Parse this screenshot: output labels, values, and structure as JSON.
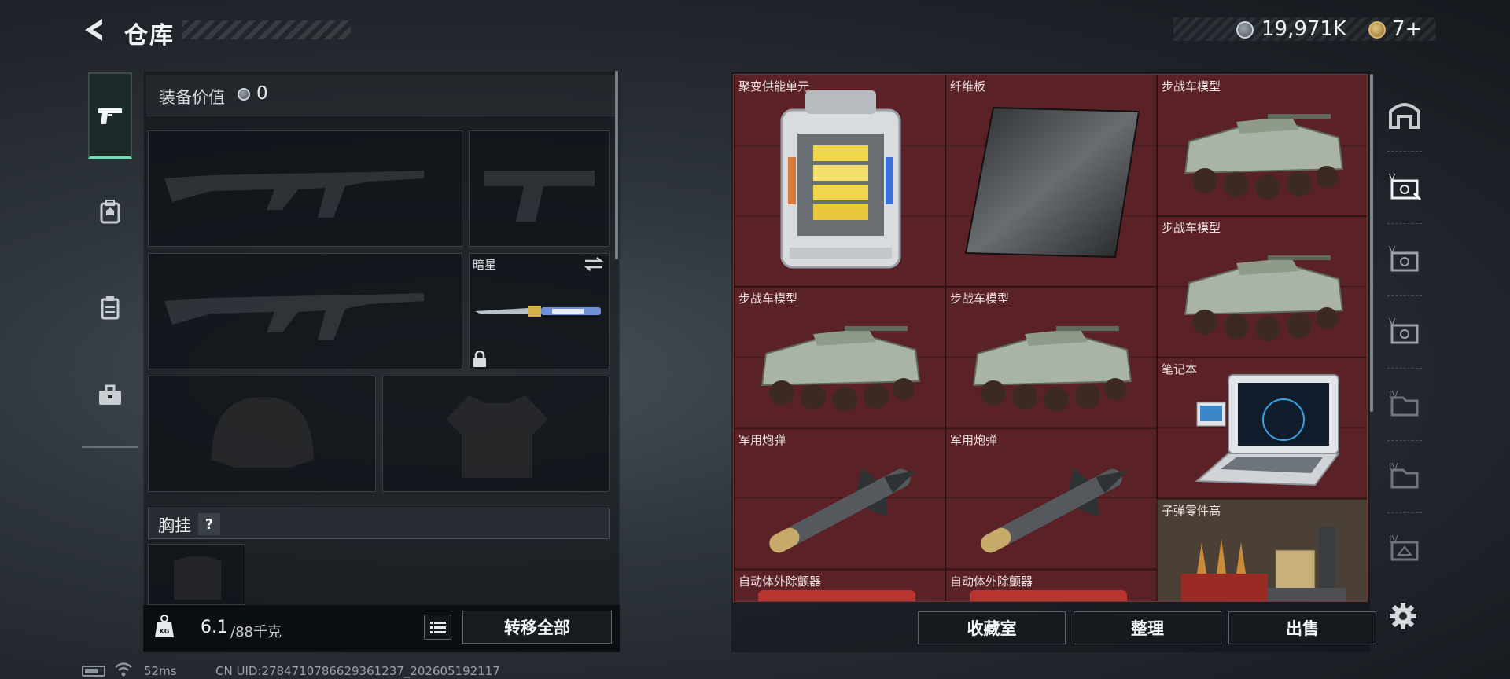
{
  "header": {
    "title": "仓库",
    "money": "19,971K",
    "tickets": "7+"
  },
  "left_tabs": [
    "weapons-icon",
    "backpack-icon",
    "vest-icon",
    "toolbox-icon"
  ],
  "loadout": {
    "equip_value_label": "装备价值",
    "equip_value": "0",
    "melee_name": "暗星",
    "chest_rig_label": "胸挂",
    "chest_rig_help": "?"
  },
  "weight": {
    "icon_text": "KG",
    "current": "6.1",
    "max": "/88千克"
  },
  "buttons": {
    "transfer_all": "转移全部",
    "collection": "收藏室",
    "sort": "整理",
    "sell": "出售"
  },
  "status": {
    "ping": "52ms",
    "uid": "CN UID:2784710786629361237_202605192117"
  },
  "stash_items": [
    {
      "name": "聚变供能单元",
      "icon": "fusion-cell"
    },
    {
      "name": "纤维板",
      "icon": "carbon-fiber-board"
    },
    {
      "name": "步战车模型",
      "icon": "ifv-model"
    },
    {
      "name": "步战车模型",
      "icon": "ifv-model"
    },
    {
      "name": "步战车模型",
      "icon": "ifv-model"
    },
    {
      "name": "步战车模型",
      "icon": "ifv-model"
    },
    {
      "name": "笔记本",
      "icon": "laptop"
    },
    {
      "name": "军用炮弹",
      "icon": "military-shell"
    },
    {
      "name": "军用炮弹",
      "icon": "military-shell"
    },
    {
      "name": "子弹零件高",
      "icon": "ammo-parts"
    },
    {
      "name": "自动体外除颤器",
      "icon": "defibrillator"
    },
    {
      "name": "自动体外除颤器",
      "icon": "defibrillator"
    }
  ],
  "right_tabs": [
    "home-icon",
    "stash-tab-1-icon",
    "stash-tab-2-icon",
    "stash-tab-3-icon",
    "stash-tab-4-icon",
    "stash-tab-5-icon",
    "stash-tab-6-icon"
  ],
  "colors": {
    "accent_green": "#6fe0b0",
    "stash_bg": "#5a2226"
  }
}
